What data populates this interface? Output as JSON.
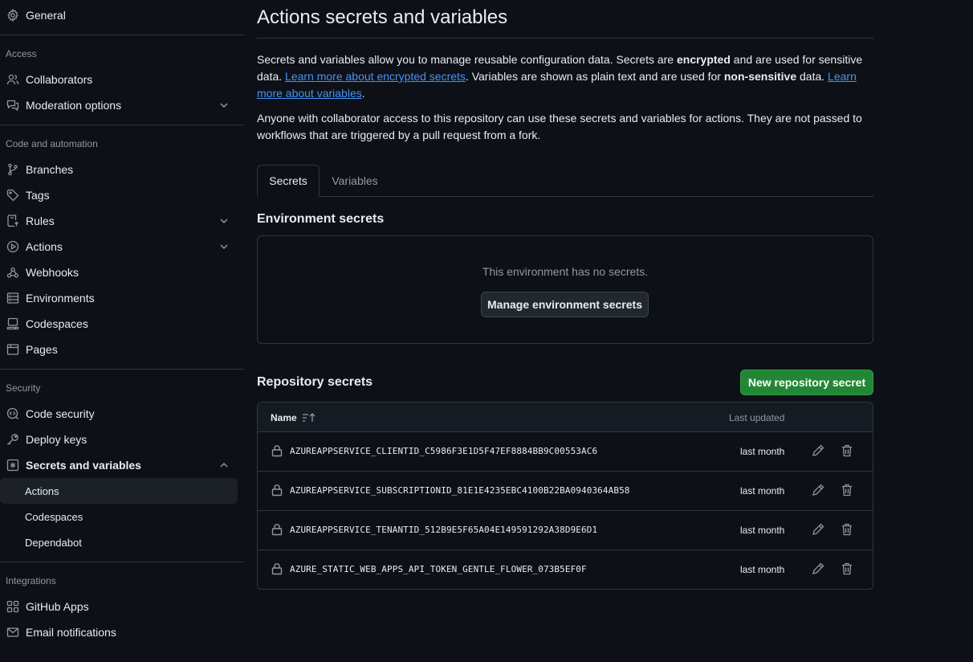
{
  "sidebar": {
    "general": "General",
    "access_heading": "Access",
    "collaborators": "Collaborators",
    "moderation": "Moderation options",
    "code_heading": "Code and automation",
    "branches": "Branches",
    "tags": "Tags",
    "rules": "Rules",
    "actions": "Actions",
    "webhooks": "Webhooks",
    "environments": "Environments",
    "codespaces": "Codespaces",
    "pages": "Pages",
    "security_heading": "Security",
    "code_security": "Code security",
    "deploy_keys": "Deploy keys",
    "secrets_variables": "Secrets and variables",
    "sub_actions": "Actions",
    "sub_codespaces": "Codespaces",
    "sub_dependabot": "Dependabot",
    "integrations_heading": "Integrations",
    "github_apps": "GitHub Apps",
    "email_notifications": "Email notifications"
  },
  "main": {
    "title": "Actions secrets and variables",
    "desc1": {
      "t1": "Secrets and variables allow you to manage reusable configuration data. Secrets are ",
      "b1": "encrypted",
      "t2": " and are used for sensitive data. ",
      "link1": "Learn more about encrypted secrets",
      "t3": ". Variables are shown as plain text and are used for ",
      "b2": "non-sensitive",
      "t4": " data. ",
      "link2": "Learn more about variables",
      "t5": "."
    },
    "desc2": "Anyone with collaborator access to this repository can use these secrets and variables for actions. They are not passed to workflows that are triggered by a pull request from a fork.",
    "tabs": {
      "secrets": "Secrets",
      "variables": "Variables"
    },
    "env": {
      "title": "Environment secrets",
      "empty": "This environment has no secrets.",
      "manage_button": "Manage environment secrets"
    },
    "repo": {
      "title": "Repository secrets",
      "new_button": "New repository secret",
      "col_name": "Name",
      "col_updated": "Last updated",
      "rows": [
        {
          "name": "AZUREAPPSERVICE_CLIENTID_C5986F3E1D5F47EF8884BB9C00553AC6",
          "updated": "last month"
        },
        {
          "name": "AZUREAPPSERVICE_SUBSCRIPTIONID_81E1E4235EBC4100B22BA0940364AB58",
          "updated": "last month"
        },
        {
          "name": "AZUREAPPSERVICE_TENANTID_512B9E5F65A04E149591292A38D9E6D1",
          "updated": "last month"
        },
        {
          "name": "AZURE_STATIC_WEB_APPS_API_TOKEN_GENTLE_FLOWER_073B5EF0F",
          "updated": "last month"
        }
      ]
    }
  }
}
